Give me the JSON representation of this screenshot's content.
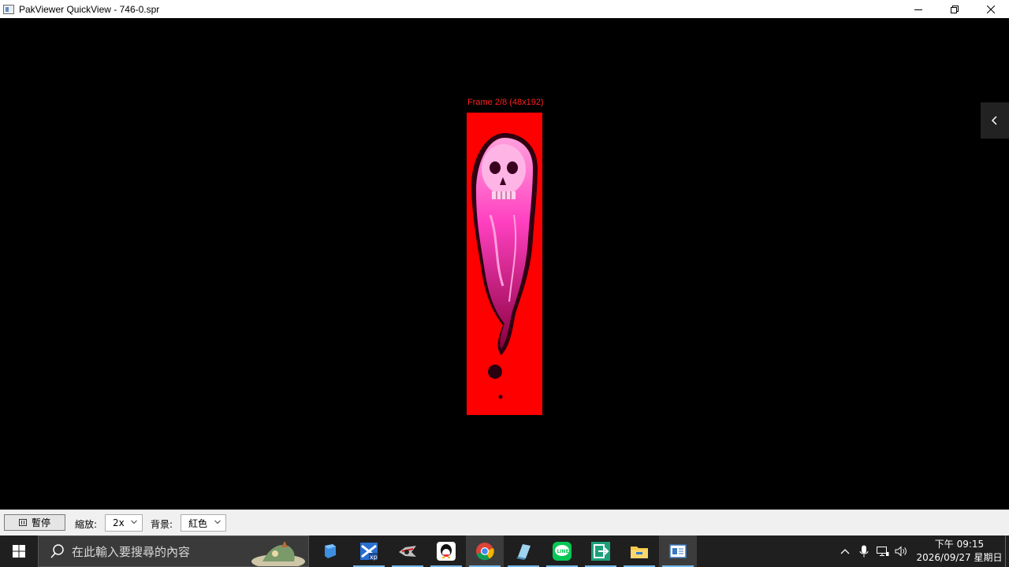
{
  "window": {
    "title": "PakViewer QuickView - 746-0.spr",
    "controls": [
      "minimize",
      "restore",
      "close"
    ]
  },
  "viewer": {
    "frame_label": "Frame 2/8 (48x192)",
    "background_color": "#ff0000",
    "side_toggle_icon": "chevron-left-icon"
  },
  "controls": {
    "pause_label": "暫停",
    "zoom_label": "縮放:",
    "zoom_value": "2x",
    "bg_label": "背景:",
    "bg_value": "紅色"
  },
  "taskbar": {
    "search_placeholder": "在此輸入要搜尋的內容",
    "apps": [
      {
        "name": "blue-shield-app-icon",
        "running": false
      },
      {
        "name": "xp-tool-app-icon",
        "running": true
      },
      {
        "name": "game-client-app-icon",
        "running": true
      },
      {
        "name": "qq-app-icon",
        "running": true
      },
      {
        "name": "chrome-app-icon",
        "running": true
      },
      {
        "name": "notepad-app-icon",
        "running": true
      },
      {
        "name": "line-app-icon",
        "running": true
      },
      {
        "name": "remote-transfer-app-icon",
        "running": true
      },
      {
        "name": "file-explorer-app-icon",
        "running": true
      },
      {
        "name": "pakviewer-app-icon",
        "running": true,
        "active": true
      }
    ],
    "clock_time": "下午 09:15",
    "clock_date": "2026/09/27 星期日"
  }
}
